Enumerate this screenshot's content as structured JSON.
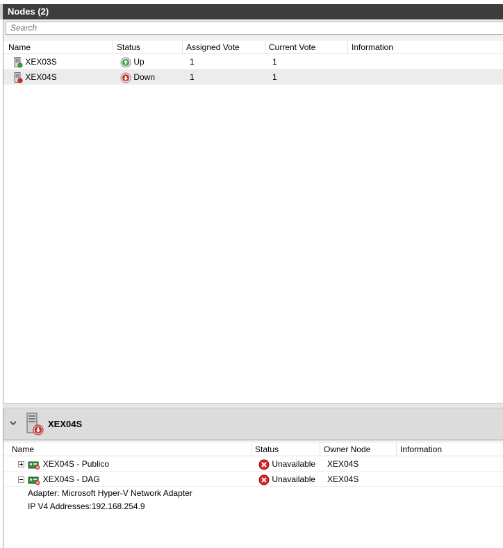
{
  "panel": {
    "title": "Nodes (2)"
  },
  "search": {
    "placeholder": "Search"
  },
  "nodes_table": {
    "columns": [
      "Name",
      "Status",
      "Assigned Vote",
      "Current Vote",
      "Information"
    ],
    "rows": [
      {
        "name": "XEX03S",
        "status": "Up",
        "status_icon": "up-arrow-icon",
        "assigned_vote": "1",
        "current_vote": "1",
        "information": ""
      },
      {
        "name": "XEX04S",
        "status": "Down",
        "status_icon": "down-arrow-icon",
        "assigned_vote": "1",
        "current_vote": "1",
        "information": ""
      }
    ]
  },
  "detail": {
    "title": "XEX04S",
    "columns": [
      "Name",
      "Status",
      "Owner Node",
      "Information"
    ],
    "rows": [
      {
        "name": "XEX04S - Publico",
        "status": "Unavailable",
        "owner": "XEX04S",
        "expanded": false
      },
      {
        "name": "XEX04S - DAG",
        "status": "Unavailable",
        "owner": "XEX04S",
        "expanded": true
      }
    ],
    "expanded_info": {
      "adapter": "Adapter: Microsoft Hyper-V Network Adapter",
      "ip": "IP V4 Addresses:192.168.254.9"
    }
  },
  "colors": {
    "titlebar": "#3d3d3d",
    "up": "#3aa33a",
    "down": "#d42b2b",
    "error": "#d9262c"
  }
}
